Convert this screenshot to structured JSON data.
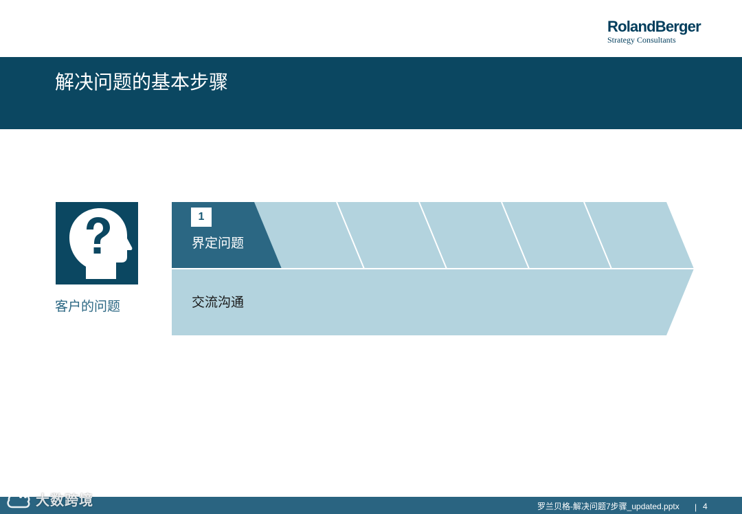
{
  "brand": {
    "name": "RolandBerger",
    "tagline": "Strategy Consultants",
    "color": "#003d5c"
  },
  "header": {
    "title": "解决问题的基本步骤",
    "bar_color": "#0b4761"
  },
  "client": {
    "icon": "head-question-icon",
    "label": "客户的问题"
  },
  "process": {
    "active_step": {
      "number": "1",
      "label": "界定问题",
      "color": "#2b6783"
    },
    "inactive_color": "#b3d3de",
    "row_label": "交流沟通"
  },
  "footer": {
    "file": "罗兰贝格-解决问题7步骤_updated.pptx",
    "separator": "|",
    "page": "4",
    "bar_color": "#2a6481"
  },
  "watermark": {
    "text": "大数跨境",
    "icon": "cloud-logo-icon"
  }
}
